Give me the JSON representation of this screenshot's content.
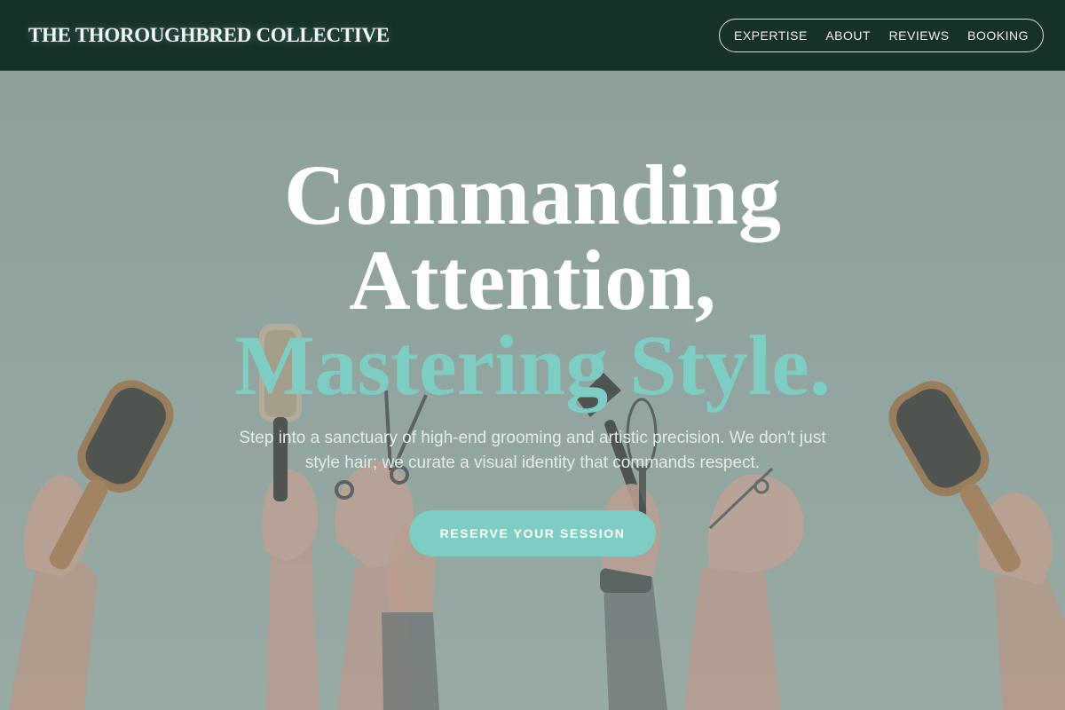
{
  "header": {
    "brand": "THE THOROUGHBRED COLLECTIVE",
    "nav": [
      "EXPERTISE",
      "ABOUT",
      "REVIEWS",
      "BOOKING"
    ]
  },
  "hero": {
    "headline_line1": "Commanding",
    "headline_line2": "Attention,",
    "headline_line3": "Mastering Style.",
    "subtext": "Step into a sanctuary of high-end grooming and artistic precision. We don't just style hair; we curate a visual identity that commands respect.",
    "cta_label": "RESERVE YOUR SESSION",
    "background_image": {
      "items": [
        "paddle-brush",
        "round-brush",
        "scissors",
        "tint-brush",
        "whisk",
        "shears",
        "paddle-brush"
      ]
    }
  },
  "colors": {
    "header_bg": "#173029",
    "accent": "#7ecdc3",
    "hero_overlay": "#8fa19c",
    "text_light": "#ffffff"
  }
}
